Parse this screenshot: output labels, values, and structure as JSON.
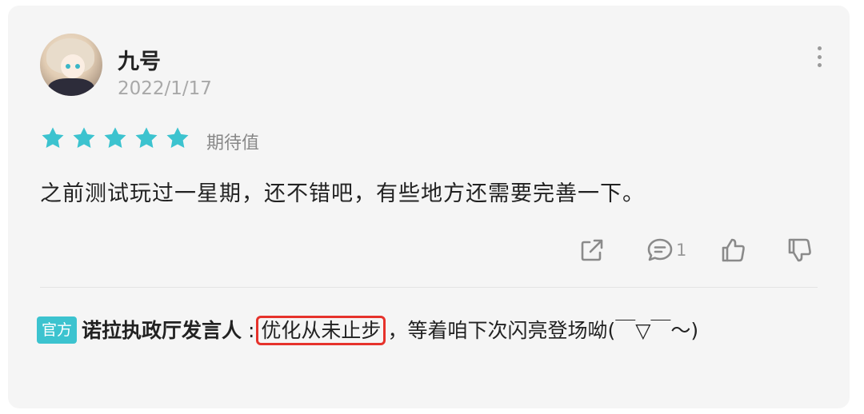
{
  "review": {
    "username": "九号",
    "date": "2022/1/17",
    "rating": 5,
    "rating_max": 5,
    "rating_label": "期待值",
    "content": "之前测试玩过一星期，还不错吧，有些地方还需要完善一下。",
    "comment_count": "1",
    "colors": {
      "star": "#3cc3cf",
      "highlight_box": "#e6322b",
      "badge_bg": "#3cc3cf"
    },
    "icons": [
      "share-icon",
      "comment-icon",
      "thumbs-up-icon",
      "thumbs-down-icon",
      "more-vertical-icon"
    ]
  },
  "official_reply": {
    "badge": "官方",
    "author": "诺拉执政厅发言人",
    "separator": ":",
    "highlighted": "优化从未止步",
    "rest": "，等着咱下次闪亮登场呦(￣▽￣～)"
  }
}
